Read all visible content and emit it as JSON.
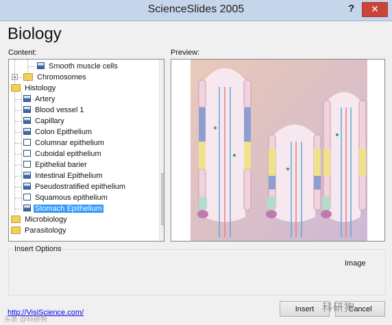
{
  "window": {
    "title": "ScienceSlides 2005",
    "help_label": "?",
    "close_label": "✕"
  },
  "heading": "Biology",
  "content_label": "Content:",
  "preview_label": "Preview:",
  "tree": [
    {
      "label": "Smooth muscle cells",
      "icon": "doc-img",
      "level": 2
    },
    {
      "label": "Chromosomes",
      "icon": "folder",
      "level": 1,
      "expander": "+"
    },
    {
      "label": "Histology",
      "icon": "folder",
      "level": 0
    },
    {
      "label": "Artery",
      "icon": "doc-img",
      "level": 1
    },
    {
      "label": "Blood vessel 1",
      "icon": "doc-img",
      "level": 1
    },
    {
      "label": "Capillary",
      "icon": "doc-img",
      "level": 1
    },
    {
      "label": "Colon Epithelium",
      "icon": "doc-img",
      "level": 1
    },
    {
      "label": "Columnar epithelium",
      "icon": "doc",
      "level": 1
    },
    {
      "label": "Cuboidal epithelium",
      "icon": "doc",
      "level": 1
    },
    {
      "label": "Epithelial barier",
      "icon": "doc",
      "level": 1
    },
    {
      "label": "Intestinal Epithelium",
      "icon": "doc-img",
      "level": 1
    },
    {
      "label": "Pseudostratified epithelium",
      "icon": "doc-img",
      "level": 1
    },
    {
      "label": "Squamous epithelium",
      "icon": "doc",
      "level": 1
    },
    {
      "label": "Stomach Epithelium",
      "icon": "doc-img",
      "level": 1,
      "selected": true
    },
    {
      "label": "Microbiology",
      "icon": "folder",
      "level": 0
    },
    {
      "label": "Parasitology",
      "icon": "folder",
      "level": 0
    }
  ],
  "insert_options": {
    "legend": "Insert Options",
    "type_label": "Image"
  },
  "link": "http://VisiScience.com/",
  "buttons": {
    "insert": "Insert",
    "cancel": "Cancel"
  },
  "watermark": "科研狗",
  "watermark2": "头条 @科研狗"
}
